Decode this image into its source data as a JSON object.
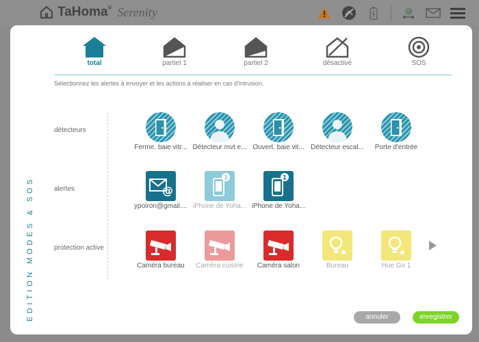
{
  "app": {
    "brand": "TaHoma",
    "brand_suffix": "Serenity",
    "reg": "®"
  },
  "topbar_icons": [
    "house-logo-icon",
    "warning-icon",
    "no-signal-icon",
    "battery-icon",
    "network-icon",
    "mail-icon",
    "hamburger-menu-icon"
  ],
  "modal_title": "EDITION MODES & SOS",
  "tabs": [
    {
      "label": "total",
      "active": true
    },
    {
      "label": "partiel 1",
      "active": false
    },
    {
      "label": "partiel 2",
      "active": false
    },
    {
      "label": "désactivé",
      "active": false
    },
    {
      "label": "SOS",
      "active": false
    }
  ],
  "instructions": "Sélectionnez les alertes à envoyer et les actions à réaliser en cas d'intrusion.",
  "rows": {
    "detecteurs": {
      "label": "détecteurs",
      "items": [
        {
          "label": "Ferme. baie vitr...",
          "icon": "door-sensor-icon"
        },
        {
          "label": "Détecteur mvt e...",
          "icon": "motion-detector-icon"
        },
        {
          "label": "Ouvert. baie vit...",
          "icon": "door-sensor-icon"
        },
        {
          "label": "Détecteur escal...",
          "icon": "motion-detector-icon"
        },
        {
          "label": "Porte d'entrée",
          "icon": "door-sensor-icon"
        }
      ]
    },
    "alertes": {
      "label": "alertes",
      "items": [
        {
          "label": "ypoiron@gmail....",
          "icon": "email-alert-icon",
          "enabled": true
        },
        {
          "label": "iPhone de Yoha...",
          "icon": "phone-alert-icon",
          "enabled": false,
          "badge": "1"
        },
        {
          "label": "iPhone de Yoha...",
          "icon": "phone-alert-icon",
          "enabled": true,
          "badge": "1"
        }
      ]
    },
    "protection": {
      "label": "protection active",
      "items": [
        {
          "label": "Caméra bureau",
          "icon": "camera-icon",
          "enabled": true
        },
        {
          "label": "Caméra cuisine",
          "icon": "camera-icon",
          "enabled": false
        },
        {
          "label": "Caméra salon",
          "icon": "camera-icon",
          "enabled": true
        },
        {
          "label": "Bureau",
          "icon": "light-bulb-icon",
          "enabled": false
        },
        {
          "label": "Hue Go 1",
          "icon": "light-bulb-icon",
          "enabled": false
        }
      ]
    }
  },
  "buttons": {
    "cancel": "annuler",
    "save": "enregistrer"
  },
  "colors": {
    "teal": "#1b7f9a",
    "accent_green": "#7ed32a",
    "camera_red": "#d92b2b",
    "bulb_yellow": "#f3e77a",
    "gray_button": "#a8a8a8"
  }
}
